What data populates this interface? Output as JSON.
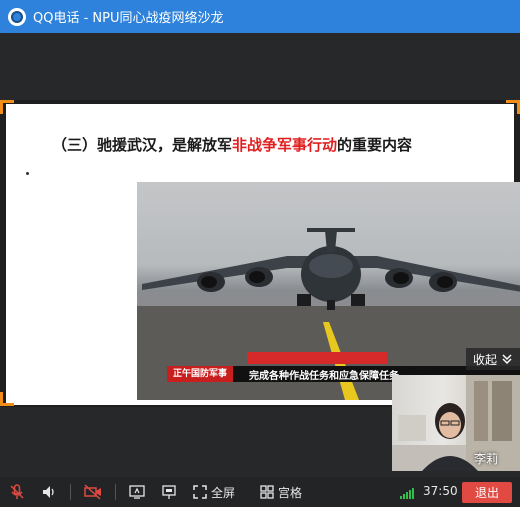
{
  "window": {
    "title": "QQ电话 - NPU同心战疫网络沙龙"
  },
  "slide": {
    "heading_prefix": "（三）驰援武汉，是解放军",
    "heading_emphasis": "非战争军事行动",
    "heading_suffix": "的重要内容",
    "emphasis_color": "#e02020"
  },
  "photo": {
    "news_tag": "正午国防军事",
    "news_headline": "完成各种作战任务和应急保障任务"
  },
  "collapse": {
    "label": "收起"
  },
  "participant": {
    "name": "李莉"
  },
  "toolbar": {
    "fullscreen_label": "全屏",
    "grid_label": "宫格",
    "timer": "37:50",
    "exit_label": "退出"
  },
  "colors": {
    "titlebar": "#2e82dc",
    "accent": "#f08c1a",
    "exit": "#e04a42",
    "signal": "#2fbf4a"
  }
}
